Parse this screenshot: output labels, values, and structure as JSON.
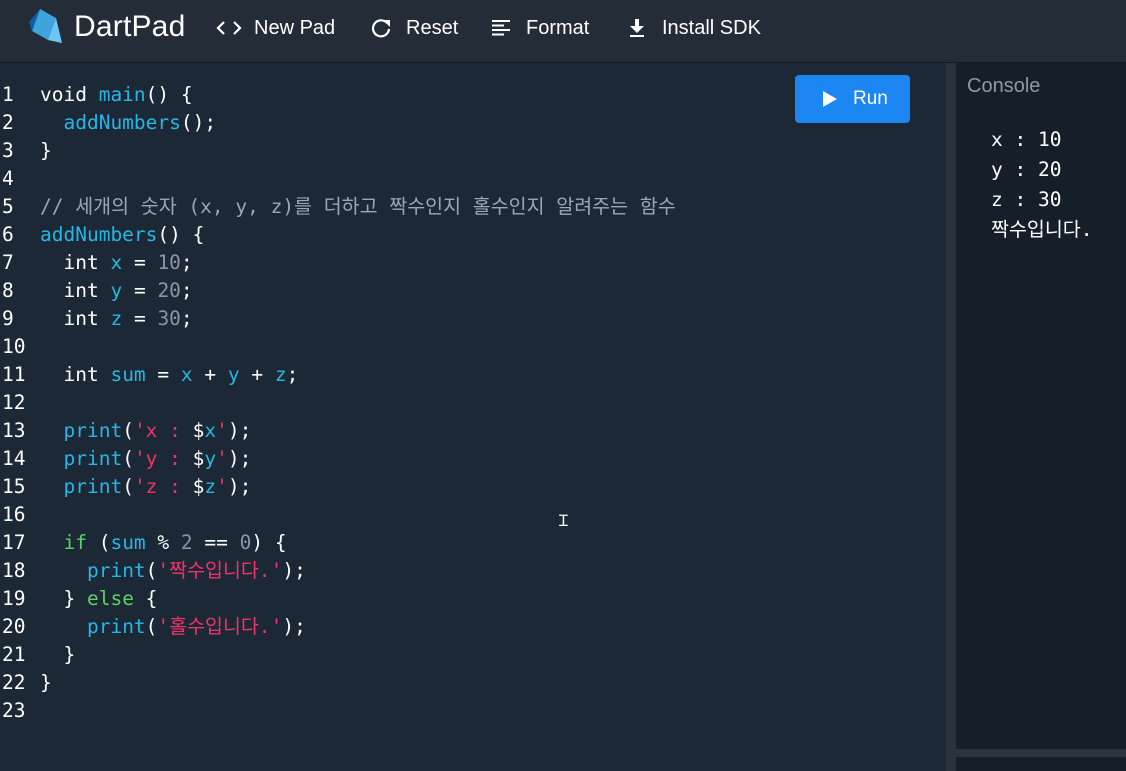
{
  "app": {
    "title": "DartPad"
  },
  "toolbar": {
    "new_pad": "New Pad",
    "reset": "Reset",
    "format": "Format",
    "install_sdk": "Install SDK"
  },
  "run_button": {
    "label": "Run"
  },
  "console": {
    "title": "Console",
    "lines": [
      "x : 10",
      "y : 20",
      "z : 30",
      "짝수입니다."
    ]
  },
  "code": {
    "lines": [
      {
        "n": "1",
        "tokens": [
          {
            "t": "void ",
            "c": "kw"
          },
          {
            "t": "main",
            "c": "fn"
          },
          {
            "t": "() {",
            "c": "kw"
          }
        ]
      },
      {
        "n": "2",
        "tokens": [
          {
            "t": "  ",
            "c": "kw"
          },
          {
            "t": "addNumbers",
            "c": "fn"
          },
          {
            "t": "();",
            "c": "kw"
          }
        ]
      },
      {
        "n": "3",
        "tokens": [
          {
            "t": "}",
            "c": "kw"
          }
        ]
      },
      {
        "n": "4",
        "tokens": []
      },
      {
        "n": "5",
        "tokens": [
          {
            "t": "// 세개의 숫자 (x, y, z)를 더하고 짝수인지 홀수인지 알려주는 함수",
            "c": "cm"
          }
        ]
      },
      {
        "n": "6",
        "tokens": [
          {
            "t": "addNumbers",
            "c": "fn"
          },
          {
            "t": "() {",
            "c": "kw"
          }
        ]
      },
      {
        "n": "7",
        "tokens": [
          {
            "t": "  int ",
            "c": "kw"
          },
          {
            "t": "x",
            "c": "id"
          },
          {
            "t": " = ",
            "c": "kw"
          },
          {
            "t": "10",
            "c": "num"
          },
          {
            "t": ";",
            "c": "kw"
          }
        ]
      },
      {
        "n": "8",
        "tokens": [
          {
            "t": "  int ",
            "c": "kw"
          },
          {
            "t": "y",
            "c": "id"
          },
          {
            "t": " = ",
            "c": "kw"
          },
          {
            "t": "20",
            "c": "num"
          },
          {
            "t": ";",
            "c": "kw"
          }
        ]
      },
      {
        "n": "9",
        "tokens": [
          {
            "t": "  int ",
            "c": "kw"
          },
          {
            "t": "z",
            "c": "id"
          },
          {
            "t": " = ",
            "c": "kw"
          },
          {
            "t": "30",
            "c": "num"
          },
          {
            "t": ";",
            "c": "kw"
          }
        ]
      },
      {
        "n": "10",
        "tokens": []
      },
      {
        "n": "11",
        "tokens": [
          {
            "t": "  int ",
            "c": "kw"
          },
          {
            "t": "sum",
            "c": "id"
          },
          {
            "t": " = ",
            "c": "kw"
          },
          {
            "t": "x",
            "c": "id"
          },
          {
            "t": " + ",
            "c": "kw"
          },
          {
            "t": "y",
            "c": "id"
          },
          {
            "t": " + ",
            "c": "kw"
          },
          {
            "t": "z",
            "c": "id"
          },
          {
            "t": ";",
            "c": "kw"
          }
        ]
      },
      {
        "n": "12",
        "tokens": []
      },
      {
        "n": "13",
        "tokens": [
          {
            "t": "  ",
            "c": "kw"
          },
          {
            "t": "print",
            "c": "fn"
          },
          {
            "t": "(",
            "c": "kw"
          },
          {
            "t": "'x : ",
            "c": "str"
          },
          {
            "t": "$",
            "c": "kw"
          },
          {
            "t": "x",
            "c": "id"
          },
          {
            "t": "'",
            "c": "str"
          },
          {
            "t": ");",
            "c": "kw"
          }
        ]
      },
      {
        "n": "14",
        "tokens": [
          {
            "t": "  ",
            "c": "kw"
          },
          {
            "t": "print",
            "c": "fn"
          },
          {
            "t": "(",
            "c": "kw"
          },
          {
            "t": "'y : ",
            "c": "str"
          },
          {
            "t": "$",
            "c": "kw"
          },
          {
            "t": "y",
            "c": "id"
          },
          {
            "t": "'",
            "c": "str"
          },
          {
            "t": ");",
            "c": "kw"
          }
        ]
      },
      {
        "n": "15",
        "tokens": [
          {
            "t": "  ",
            "c": "kw"
          },
          {
            "t": "print",
            "c": "fn"
          },
          {
            "t": "(",
            "c": "kw"
          },
          {
            "t": "'z : ",
            "c": "str"
          },
          {
            "t": "$",
            "c": "kw"
          },
          {
            "t": "z",
            "c": "id"
          },
          {
            "t": "'",
            "c": "str"
          },
          {
            "t": ");",
            "c": "kw"
          }
        ]
      },
      {
        "n": "16",
        "tokens": []
      },
      {
        "n": "17",
        "tokens": [
          {
            "t": "  ",
            "c": "kw"
          },
          {
            "t": "if",
            "c": "ctl"
          },
          {
            "t": " (",
            "c": "kw"
          },
          {
            "t": "sum",
            "c": "id"
          },
          {
            "t": " % ",
            "c": "kw"
          },
          {
            "t": "2",
            "c": "num"
          },
          {
            "t": " == ",
            "c": "kw"
          },
          {
            "t": "0",
            "c": "num"
          },
          {
            "t": ") {",
            "c": "kw"
          }
        ]
      },
      {
        "n": "18",
        "tokens": [
          {
            "t": "    ",
            "c": "kw"
          },
          {
            "t": "print",
            "c": "fn"
          },
          {
            "t": "(",
            "c": "kw"
          },
          {
            "t": "'짝수입니다.'",
            "c": "str"
          },
          {
            "t": ");",
            "c": "kw"
          }
        ]
      },
      {
        "n": "19",
        "tokens": [
          {
            "t": "  } ",
            "c": "kw"
          },
          {
            "t": "else",
            "c": "ctl"
          },
          {
            "t": " {",
            "c": "kw"
          }
        ]
      },
      {
        "n": "20",
        "tokens": [
          {
            "t": "    ",
            "c": "kw"
          },
          {
            "t": "print",
            "c": "fn"
          },
          {
            "t": "(",
            "c": "kw"
          },
          {
            "t": "'홀수입니다.'",
            "c": "str"
          },
          {
            "t": ");",
            "c": "kw"
          }
        ]
      },
      {
        "n": "21",
        "tokens": [
          {
            "t": "  }",
            "c": "kw"
          }
        ]
      },
      {
        "n": "22",
        "tokens": [
          {
            "t": "}",
            "c": "kw"
          }
        ]
      },
      {
        "n": "23",
        "tokens": []
      }
    ]
  },
  "colors": {
    "background": "#1c2835",
    "header": "#242c38",
    "run_button": "#1c86f2",
    "function": "#24b7e6",
    "string": "#f0336a",
    "control": "#5cd164",
    "number": "#8c96a1"
  }
}
